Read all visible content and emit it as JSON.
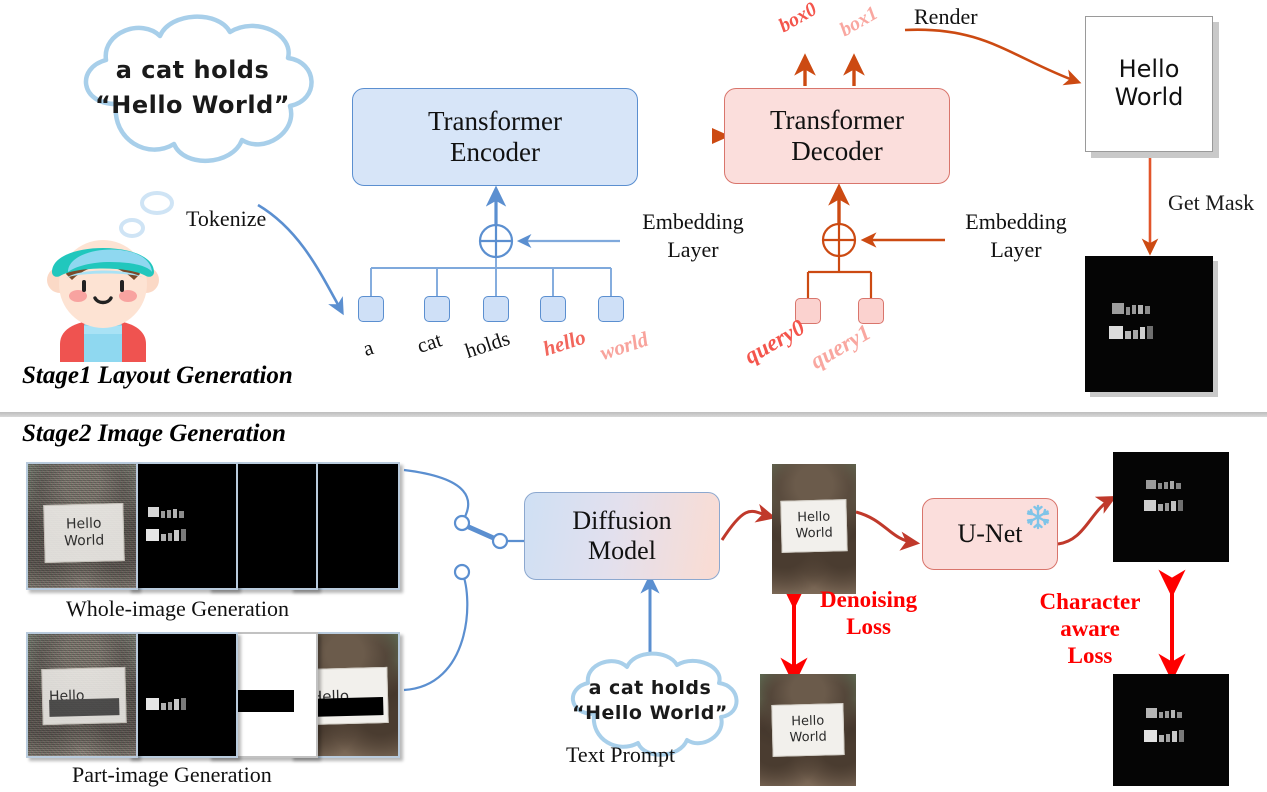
{
  "figure": {
    "stage1_title": "Stage1 Layout Generation",
    "stage2_title": "Stage2 Image Generation"
  },
  "stage1": {
    "prompt_cloud": {
      "line1": "a cat holds",
      "line2": "“Hello World”"
    },
    "tokenize_label": "Tokenize",
    "encoder": {
      "line1": "Transformer",
      "line2": "Encoder"
    },
    "decoder": {
      "line1": "Transformer",
      "line2": "Decoder"
    },
    "embedding_left": {
      "line1": "Embedding",
      "line2": "Layer"
    },
    "embedding_right": {
      "line1": "Embedding",
      "line2": "Layer"
    },
    "tokens": [
      {
        "label": "a",
        "style": "black"
      },
      {
        "label": "cat",
        "style": "black"
      },
      {
        "label": "holds",
        "style": "black"
      },
      {
        "label": "hello",
        "style": "red"
      },
      {
        "label": "world",
        "style": "pink"
      }
    ],
    "queries": [
      {
        "label": "query0",
        "style": "red"
      },
      {
        "label": "query1",
        "style": "pink"
      }
    ],
    "box_outputs": [
      {
        "label": "box0",
        "style": "red"
      },
      {
        "label": "box1",
        "style": "pink"
      }
    ],
    "render_label": "Render",
    "render_card": {
      "line1": "Hello",
      "line2": "World"
    },
    "get_mask_label": "Get Mask",
    "mask_text": [
      "Hello",
      "World"
    ]
  },
  "stage2": {
    "whole_image_caption": "Whole-image Generation",
    "part_image_caption": "Part-image Generation",
    "diffusion_model": {
      "line1": "Diffusion",
      "line2": "Model"
    },
    "unet": {
      "label": "U-Net",
      "frozen_icon": "snowflake-icon"
    },
    "text_prompt_cloud": {
      "line1": "a cat holds",
      "line2": "“Hello World”"
    },
    "text_prompt_caption": "Text Prompt",
    "denoising_loss": {
      "line1": "Denoising",
      "line2": "Loss"
    },
    "character_aware_loss": {
      "line1": "Character",
      "line2": "aware",
      "line3": "Loss"
    },
    "sign_text": {
      "line1": "Hello",
      "line2": "World"
    },
    "sign_text_part": "Hello",
    "mask_text": [
      "Hello",
      "World"
    ]
  },
  "colors": {
    "encoder_fill": "#d7e5f8",
    "encoder_stroke": "#5b8fd0",
    "decoder_fill": "#fbdedc",
    "decoder_stroke": "#d9756c",
    "loss_red": "#fe0000",
    "token_red": "#f4554c",
    "token_pink": "#f9a7a0",
    "arrow_blue": "#5b8fd0",
    "arrow_orange": "#cc4a12",
    "arrow_darkred": "#c0392b",
    "snowflake": "#7fc4e8"
  }
}
